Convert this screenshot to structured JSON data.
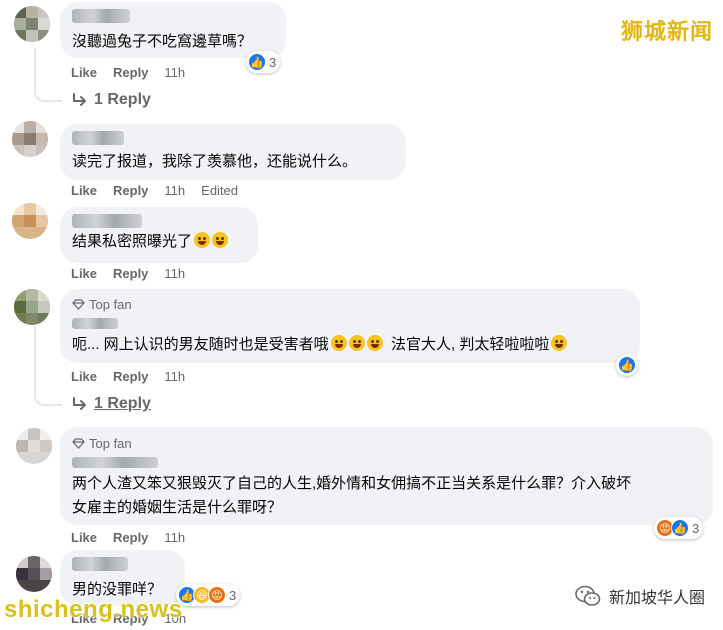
{
  "watermarks": {
    "top_right": "狮城新闻",
    "bottom_left": "shicheng.news",
    "wechat_account": "新加坡华人圈"
  },
  "actions": {
    "like": "Like",
    "reply": "Reply",
    "edited": "Edited"
  },
  "comments": [
    {
      "text": "沒聽過兔子不吃窩邊草嗎？",
      "time": "11h",
      "reactions": "3",
      "replies": "1 Reply"
    },
    {
      "text": "读完了报道，我除了羡慕他，还能说什么。",
      "time": "11h"
    },
    {
      "text": "结果私密照曝光了",
      "time": "11h"
    },
    {
      "badge": "Top fan",
      "text": "呃... 网上认识的男友随时也是受害者哦",
      "text2": "法官大人, 判太轻啦啦啦",
      "time": "11h",
      "replies": "1 Reply"
    },
    {
      "badge": "Top fan",
      "text_line1": "两个人渣又笨又狠毁灭了自己的人生,婚外情和女佣搞不正当关系是什么罪？介入破坏",
      "text_line2": "女雇主的婚姻生活是什么罪呀？",
      "time": "11h",
      "reactions": "3"
    },
    {
      "text": "男的没罪咩？",
      "time": "10h",
      "reactions": "3"
    }
  ],
  "colors": {
    "bubble": "#f0f2f5",
    "meta": "#65676b",
    "like": "#1877f2",
    "watermark": "#e2b714"
  }
}
